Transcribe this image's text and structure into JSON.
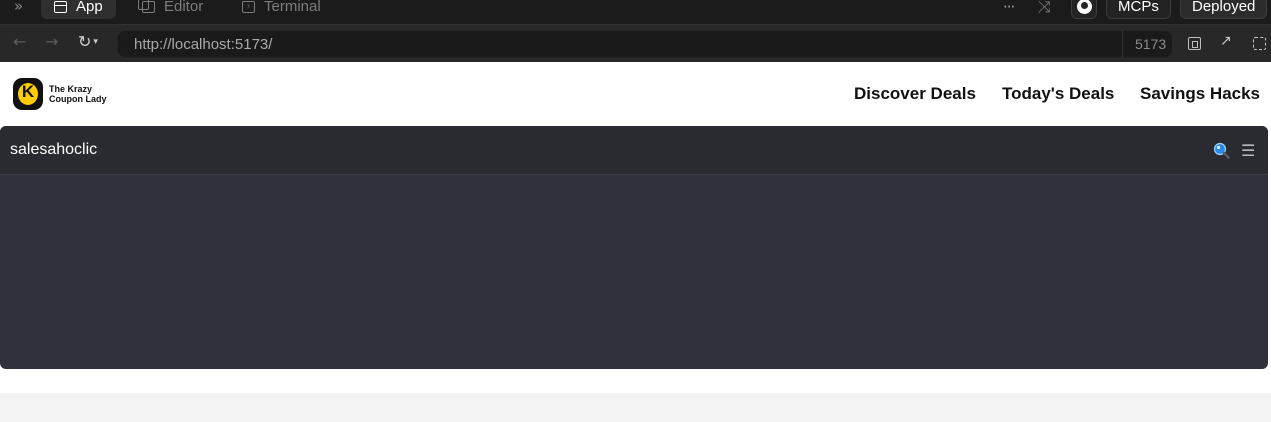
{
  "ide": {
    "tabs": [
      {
        "label": "App",
        "icon": "app-window-icon",
        "active": true
      },
      {
        "label": "Editor",
        "icon": "editor-files-icon",
        "active": false
      },
      {
        "label": "Terminal",
        "icon": "terminal-icon",
        "active": false
      }
    ],
    "mcps_label": "MCPs",
    "deployed_label": "Deployed"
  },
  "address_bar": {
    "url": "http://localhost:5173/",
    "port": "5173"
  },
  "site": {
    "logo_line1": "The Krazy",
    "logo_line2": "Coupon Lady",
    "logo_letter": "K",
    "nav": [
      "Discover Deals",
      "Today's Deals",
      "Savings Hacks"
    ],
    "brand_color": "#ffcd00"
  },
  "widget": {
    "title": "salesahoclic",
    "panel_color": "#30313a"
  }
}
